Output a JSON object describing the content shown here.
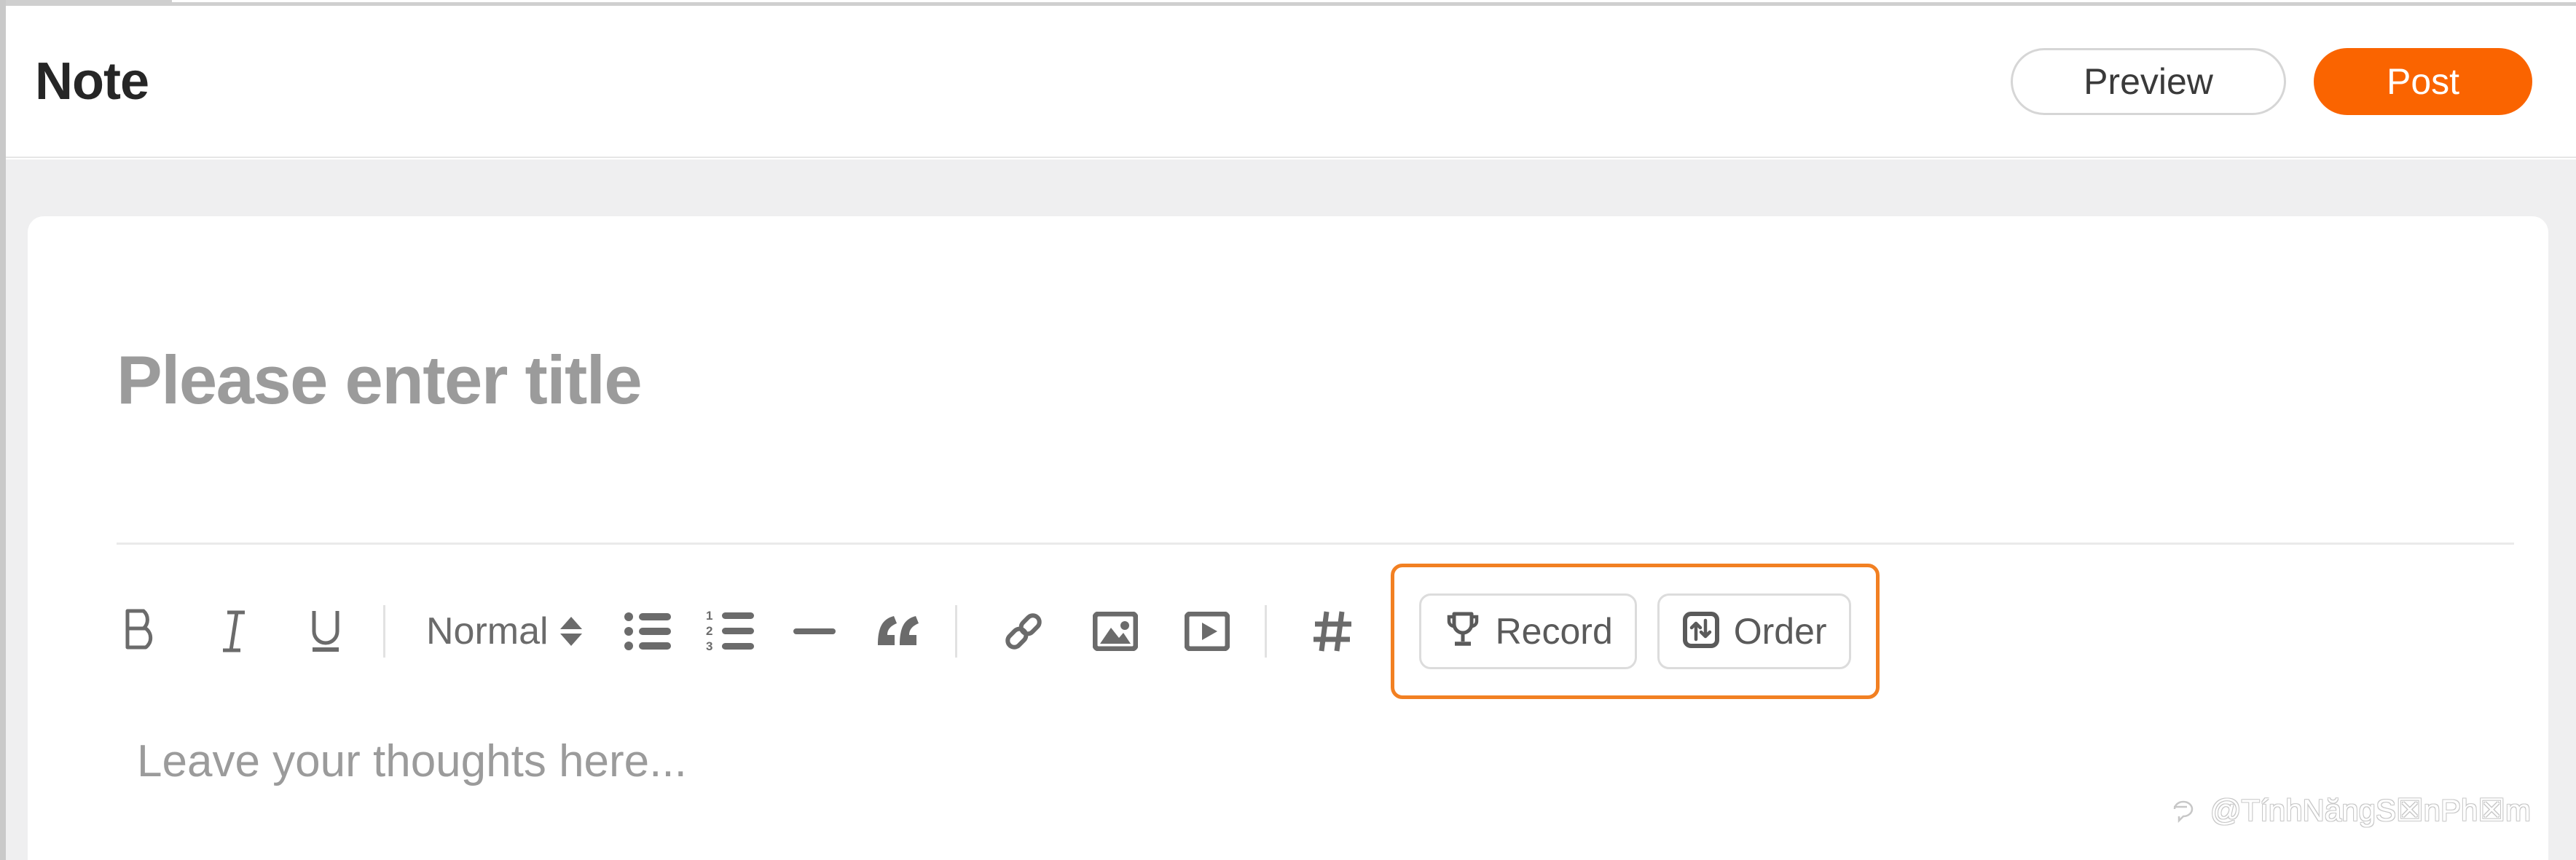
{
  "header": {
    "title": "Note",
    "preview_button": "Preview",
    "post_button": "Post",
    "post_button_color": "#FA6400"
  },
  "editor": {
    "title_placeholder": "Please enter title",
    "body_placeholder": "Leave your thoughts here..."
  },
  "toolbar": {
    "items": [
      {
        "name": "bold",
        "glyph": "B",
        "type": "glyph"
      },
      {
        "name": "italic",
        "glyph": "I",
        "type": "glyph"
      },
      {
        "name": "underline",
        "glyph": "U",
        "type": "glyph"
      },
      {
        "name": "divider",
        "type": "divider"
      },
      {
        "name": "text-style-select",
        "type": "select",
        "value": "Normal"
      },
      {
        "name": "bulleted-list",
        "type": "icon"
      },
      {
        "name": "numbered-list",
        "type": "icon"
      },
      {
        "name": "horizontal-rule",
        "type": "icon"
      },
      {
        "name": "blockquote",
        "type": "icon"
      },
      {
        "name": "divider",
        "type": "divider"
      },
      {
        "name": "link",
        "type": "icon"
      },
      {
        "name": "image",
        "type": "icon"
      },
      {
        "name": "video",
        "type": "icon"
      },
      {
        "name": "divider",
        "type": "divider"
      },
      {
        "name": "hashtag",
        "type": "icon"
      }
    ],
    "style_value": "Normal",
    "bold_label": "B",
    "italic_label": "I",
    "underline_label": "U",
    "list_numbers": [
      "1",
      "2",
      "3"
    ]
  },
  "highlight": {
    "border_color": "#F28022",
    "record_button": "Record",
    "order_button": "Order"
  },
  "watermark": {
    "handle": "@TínhNăngS☒nPh☒m"
  },
  "colors": {
    "accent_orange": "#FA6400",
    "highlight_orange": "#F28022",
    "icon_gray": "#6b6b6b",
    "placeholder_gray": "#9b9b9b",
    "band_gray": "#efeff0",
    "card_white": "#ffffff"
  }
}
